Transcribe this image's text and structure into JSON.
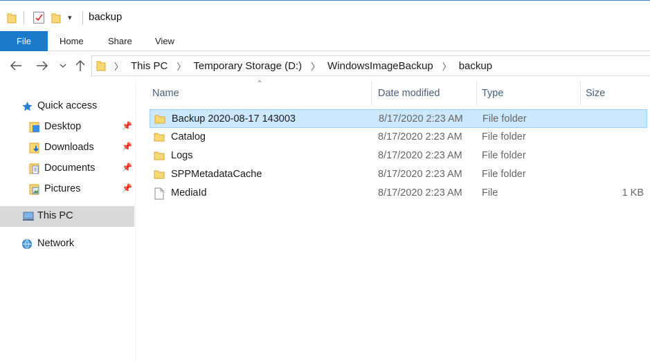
{
  "window": {
    "title": "backup"
  },
  "ribbon": {
    "tabs": [
      {
        "label": "File",
        "active": true
      },
      {
        "label": "Home"
      },
      {
        "label": "Share"
      },
      {
        "label": "View"
      }
    ],
    "file_tab_color": "#1979ca"
  },
  "address_bar": {
    "crumbs": [
      "This PC",
      "Temporary Storage (D:)",
      "WindowsImageBackup",
      "backup"
    ]
  },
  "nav_pane": {
    "items": [
      {
        "label": "Quick access",
        "icon": "star-icon"
      },
      {
        "label": "Desktop",
        "icon": "desktop-folder-icon",
        "pinned": true
      },
      {
        "label": "Downloads",
        "icon": "downloads-folder-icon",
        "pinned": true
      },
      {
        "label": "Documents",
        "icon": "documents-folder-icon",
        "pinned": true
      },
      {
        "label": "Pictures",
        "icon": "pictures-folder-icon",
        "pinned": true
      },
      {
        "label": "This PC",
        "icon": "computer-icon",
        "selected": true
      },
      {
        "label": "Network",
        "icon": "network-icon"
      }
    ]
  },
  "file_list": {
    "columns": [
      "Name",
      "Date modified",
      "Type",
      "Size"
    ],
    "rows": [
      {
        "name": "Backup 2020-08-17 143003",
        "date": "8/17/2020 2:23 AM",
        "type": "File folder",
        "size": "",
        "icon": "folder-icon",
        "selected": true
      },
      {
        "name": "Catalog",
        "date": "8/17/2020 2:23 AM",
        "type": "File folder",
        "size": "",
        "icon": "folder-icon"
      },
      {
        "name": "Logs",
        "date": "8/17/2020 2:23 AM",
        "type": "File folder",
        "size": "",
        "icon": "folder-icon"
      },
      {
        "name": "SPPMetadataCache",
        "date": "8/17/2020 2:23 AM",
        "type": "File folder",
        "size": "",
        "icon": "folder-icon"
      },
      {
        "name": "MediaId",
        "date": "8/17/2020 2:23 AM",
        "type": "File",
        "size": "1 KB",
        "icon": "file-icon"
      }
    ]
  },
  "colors": {
    "selection_bg": "#cce8ff",
    "selection_border": "#99d1ff",
    "folder_yellow": "#f8d775",
    "nav_selected_bg": "#d9d9d9"
  }
}
